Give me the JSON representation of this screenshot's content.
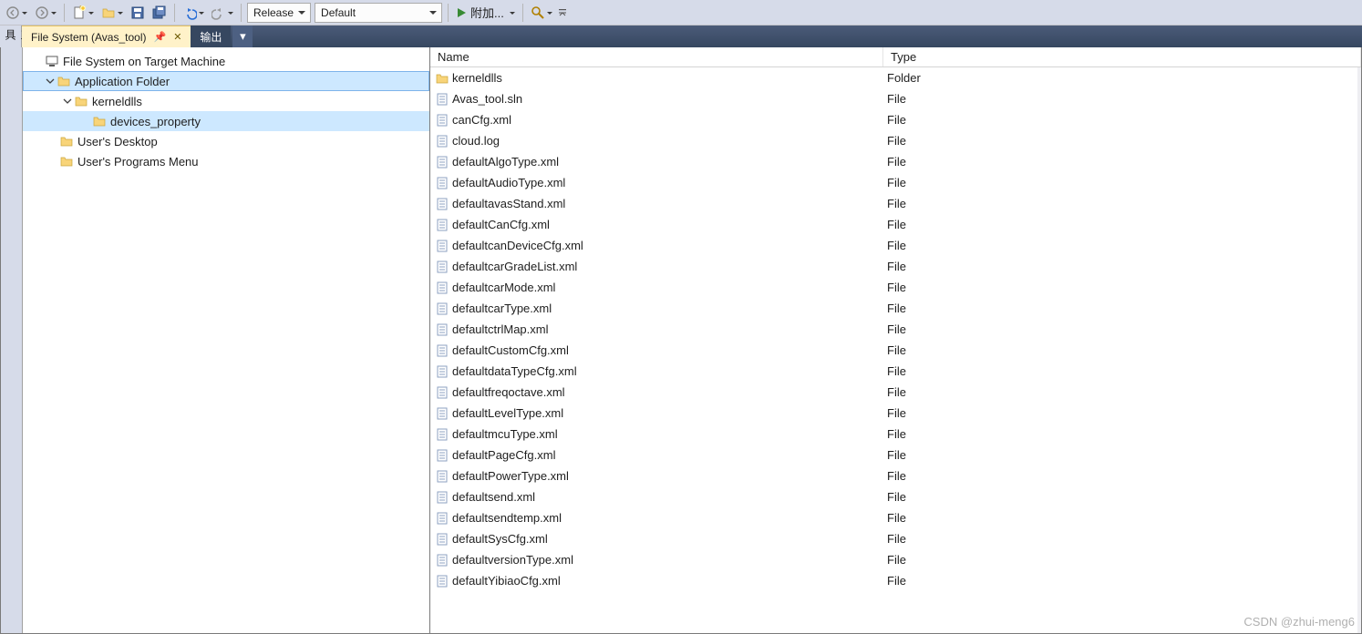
{
  "toolbar": {
    "config_combo": "Release",
    "platform_combo": "Default",
    "attach_label": "附加..."
  },
  "tabs": {
    "active": {
      "label": "File System (Avas_tool)"
    },
    "other": {
      "label": "输出"
    }
  },
  "vertical_label": "工具箱",
  "tree": {
    "root": "File System on Target Machine",
    "app_folder": "Application Folder",
    "kerneldlls": "kerneldlls",
    "devices_property": "devices_property",
    "users_desktop": "User's Desktop",
    "users_programs": "User's Programs Menu"
  },
  "columns": {
    "name": "Name",
    "type": "Type"
  },
  "items": [
    {
      "name": "kerneldlls",
      "type": "Folder",
      "icon": "folder"
    },
    {
      "name": "Avas_tool.sln",
      "type": "File",
      "icon": "file"
    },
    {
      "name": "canCfg.xml",
      "type": "File",
      "icon": "file"
    },
    {
      "name": "cloud.log",
      "type": "File",
      "icon": "file"
    },
    {
      "name": "defaultAlgoType.xml",
      "type": "File",
      "icon": "file"
    },
    {
      "name": "defaultAudioType.xml",
      "type": "File",
      "icon": "file"
    },
    {
      "name": "defaultavasStand.xml",
      "type": "File",
      "icon": "file"
    },
    {
      "name": "defaultCanCfg.xml",
      "type": "File",
      "icon": "file"
    },
    {
      "name": "defaultcanDeviceCfg.xml",
      "type": "File",
      "icon": "file"
    },
    {
      "name": "defaultcarGradeList.xml",
      "type": "File",
      "icon": "file"
    },
    {
      "name": "defaultcarMode.xml",
      "type": "File",
      "icon": "file"
    },
    {
      "name": "defaultcarType.xml",
      "type": "File",
      "icon": "file"
    },
    {
      "name": "defaultctrlMap.xml",
      "type": "File",
      "icon": "file"
    },
    {
      "name": "defaultCustomCfg.xml",
      "type": "File",
      "icon": "file"
    },
    {
      "name": "defaultdataTypeCfg.xml",
      "type": "File",
      "icon": "file"
    },
    {
      "name": "defaultfreqoctave.xml",
      "type": "File",
      "icon": "file"
    },
    {
      "name": "defaultLevelType.xml",
      "type": "File",
      "icon": "file"
    },
    {
      "name": "defaultmcuType.xml",
      "type": "File",
      "icon": "file"
    },
    {
      "name": "defaultPageCfg.xml",
      "type": "File",
      "icon": "file"
    },
    {
      "name": "defaultPowerType.xml",
      "type": "File",
      "icon": "file"
    },
    {
      "name": "defaultsend.xml",
      "type": "File",
      "icon": "file"
    },
    {
      "name": "defaultsendtemp.xml",
      "type": "File",
      "icon": "file"
    },
    {
      "name": "defaultSysCfg.xml",
      "type": "File",
      "icon": "file"
    },
    {
      "name": "defaultversionType.xml",
      "type": "File",
      "icon": "file"
    },
    {
      "name": "defaultYibiaoCfg.xml",
      "type": "File",
      "icon": "file"
    }
  ],
  "watermark": "CSDN @zhui-meng6"
}
